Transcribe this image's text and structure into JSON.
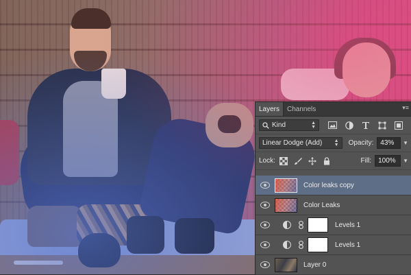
{
  "panel": {
    "tabs": [
      {
        "label": "Layers",
        "active": true
      },
      {
        "label": "Channels",
        "active": false
      }
    ],
    "menu_icon": "panel-menu-icon",
    "filter": {
      "kind_label": "Kind",
      "icons": [
        "image-filter-icon",
        "adjustment-filter-icon",
        "type-filter-icon",
        "shape-filter-icon",
        "smart-object-filter-icon"
      ]
    },
    "blend_mode": "Linear Dodge (Add)",
    "opacity_label": "Opacity:",
    "opacity_value": "43%",
    "lock_label": "Lock:",
    "lock_icons": [
      "lock-transparency-icon",
      "lock-image-icon",
      "lock-position-icon",
      "lock-all-icon"
    ],
    "fill_label": "Fill:",
    "fill_value": "100%"
  },
  "layers": [
    {
      "name": "Color leaks copy",
      "type": "pixel",
      "selected": true,
      "visible": true
    },
    {
      "name": "Color Leaks",
      "type": "pixel",
      "selected": false,
      "visible": true
    },
    {
      "name": "Levels 1",
      "type": "adjustment",
      "selected": false,
      "visible": true
    },
    {
      "name": "Levels 1",
      "type": "adjustment",
      "selected": false,
      "visible": true
    },
    {
      "name": "Layer 0",
      "type": "photo",
      "selected": false,
      "visible": true
    }
  ],
  "colors": {
    "panel_bg": "#535353",
    "tab_bar_bg": "#383838",
    "selected_layer": "#5f6e87"
  }
}
